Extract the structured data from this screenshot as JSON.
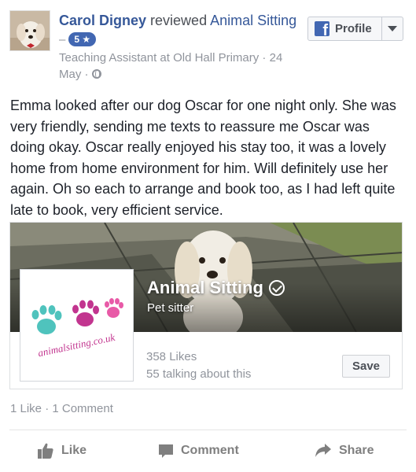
{
  "review": {
    "reviewer_name": "Carol Digney",
    "verb": "reviewed",
    "page_name": "Animal Sitting",
    "dash": "–",
    "rating": "5 ★",
    "meta": "Teaching Assistant at Old Hall Primary · 24 May ·",
    "text": "Emma looked after our dog Oscar for one night only. She was very friendly, sending me texts to reassure me Oscar was doing okay. Oscar really enjoyed his stay too, it was a lovely home from home environment for him. Will definitely use her again. Oh so each to arrange and book too, as I had left quite late to book, very efficient service."
  },
  "profile_button": {
    "label": "Profile",
    "icon": "facebook-icon"
  },
  "page_card": {
    "name": "Animal Sitting",
    "category": "Pet sitter",
    "likes": "358 Likes",
    "talking": "55 talking about this",
    "save_label": "Save",
    "logo_text": "animalsitting.co.uk",
    "colors": {
      "paw_teal": "#4fc3bd",
      "paw_magenta": "#c2358f",
      "paw_pink": "#e85aa7"
    }
  },
  "engagement": {
    "summary": "1 Like · 1 Comment"
  },
  "actions": {
    "like": "Like",
    "comment": "Comment",
    "share": "Share"
  },
  "colors": {
    "link_blue": "#365899",
    "meta_gray": "#90949c",
    "badge_blue": "#4267b2"
  }
}
